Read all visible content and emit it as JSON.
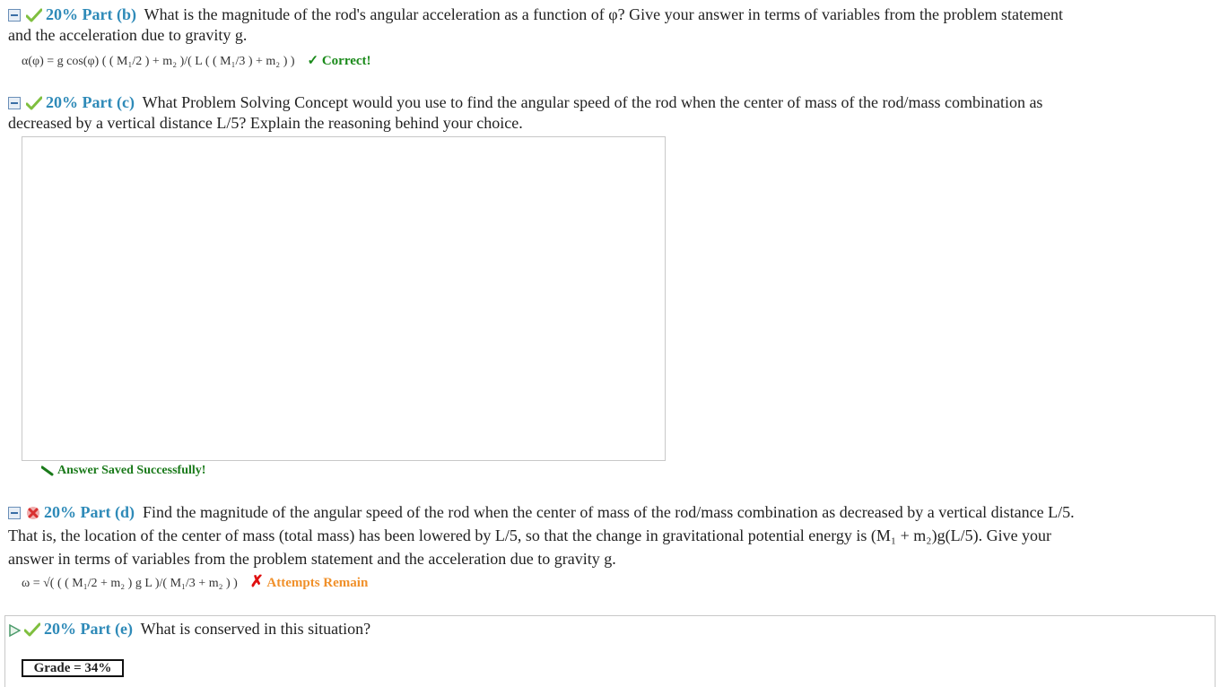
{
  "partB": {
    "header": "20% Part (b)",
    "question_l1": "What is the magnitude of the rod's angular acceleration as a function of φ? Give your answer in terms of variables from the problem statement",
    "question_l2": "and the acceleration due to gravity g.",
    "answer": "α(φ) = g cos(φ) ( ( M₁/2 ) + m₂ )/( L ( ( M₁/3 ) + m₂ ) )",
    "status": "✓ Correct!"
  },
  "partC": {
    "header": "20% Part (c)",
    "question_l1": "What Problem Solving Concept would you use to find the angular speed of the rod when the center of mass of the rod/mass combination as",
    "question_l2": "decreased by a vertical distance L/5? Explain the reasoning behind your choice.",
    "textbox_value": "",
    "saved_msg": "Answer Saved Successfully!"
  },
  "partD": {
    "header": "20% Part (d)",
    "question_l1": "Find the magnitude of the angular speed of the rod when the center of mass of the rod/mass combination as decreased by a vertical distance L/5.",
    "question_l2": "That is, the location of the center of mass (total mass) has been lowered by L/5, so that the change in gravitational potential energy is (M₁ + m₂)g(L/5). Give your",
    "question_l3": "answer in terms of variables from the problem statement and the acceleration due to gravity g.",
    "answer": "ω = √( ( ( M₁/2 + m₂ ) g L )/( M₁/3 + m₂ ) )",
    "status_mark": "✗",
    "status_text": "Attempts Remain"
  },
  "partE": {
    "header": "20% Part (e)",
    "question": "What is conserved in this situation?"
  },
  "grade": "Grade = 34%"
}
